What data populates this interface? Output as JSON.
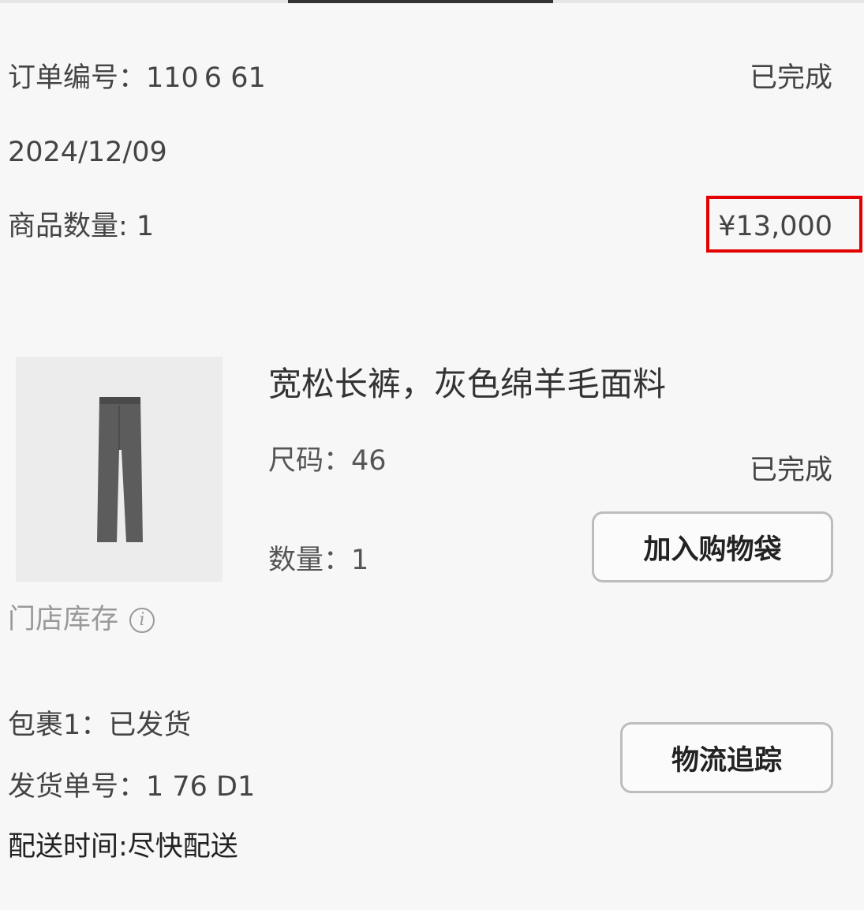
{
  "order": {
    "number_line": "订单编号：110 6  61",
    "status": "已完成",
    "date": "2024/12/09",
    "item_count": "商品数量: 1",
    "total": "¥13,000"
  },
  "product": {
    "name": "宽松长裤，灰色绵羊毛面料",
    "size": "尺码：46",
    "quantity": "数量：1",
    "status": "已完成",
    "add_to_bag_label": "加入购物袋",
    "store_stock_label": "门店库存",
    "info_icon": "info-icon"
  },
  "shipment": {
    "package_status": "包裹1：已发货",
    "tracking_number": "发货单号：1     76 D1",
    "delivery_time": "配送时间:尽快配送",
    "track_label": "物流追踪"
  },
  "colors": {
    "highlight": "#e40000",
    "background": "#f7f7f7"
  }
}
